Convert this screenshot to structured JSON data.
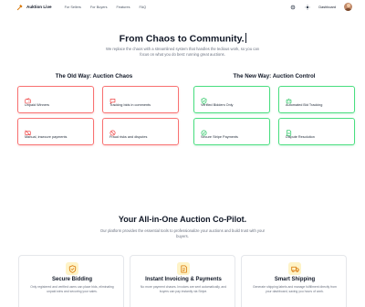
{
  "nav": {
    "brand": "Auktion Live",
    "links": [
      "For Sellers",
      "For Buyers",
      "Features",
      "FAQ"
    ],
    "dashboard": "Dashboard"
  },
  "hero": {
    "title": "From Chaos to Community.",
    "subtitle": "We replace the chaos with a streamlined system that handles the tedious work, so you can focus on what you do best: running great auctions."
  },
  "comparison": {
    "old_title": "The Old Way: Auction Chaos",
    "new_title": "The New Way: Auction Control",
    "old_items": [
      {
        "label": "Unpaid Winners",
        "icon": "wallet-icon"
      },
      {
        "label": "Tracking bids in comments",
        "icon": "comment-icon"
      },
      {
        "label": "Manual, insecure payments",
        "icon": "no-card-icon"
      },
      {
        "label": "Fraud risks and disputes",
        "icon": "ban-icon"
      }
    ],
    "new_items": [
      {
        "label": "Verified Bidders Only",
        "icon": "shield-check-icon"
      },
      {
        "label": "Automated Bid Tracking",
        "icon": "robot-icon"
      },
      {
        "label": "Secure Stripe Payments",
        "icon": "check-circle-icon"
      },
      {
        "label": "Dispute Resolution",
        "icon": "document-icon"
      }
    ],
    "colors": {
      "bad": "#ef4444",
      "good": "#22c55e"
    }
  },
  "features": {
    "title": "Your All-in-One Auction Co-Pilot.",
    "subtitle": "Our platform provides the essential tools to professionalize your auctions and build trust with your buyers.",
    "cards": [
      {
        "title": "Secure Bidding",
        "desc": "Only registered and verified users can place bids, eliminating unpaid wins and securing your sales.",
        "icon": "shield-icon"
      },
      {
        "title": "Instant Invoicing & Payments",
        "desc": "No more payment chases. Invoices are sent automatically, and buyers can pay instantly via Stripe.",
        "icon": "invoice-icon"
      },
      {
        "title": "Smart Shipping",
        "desc": "Generate shipping labels and manage fulfillment directly from your dashboard, saving you hours of work.",
        "icon": "truck-icon"
      }
    ],
    "accent": "#d97706"
  }
}
